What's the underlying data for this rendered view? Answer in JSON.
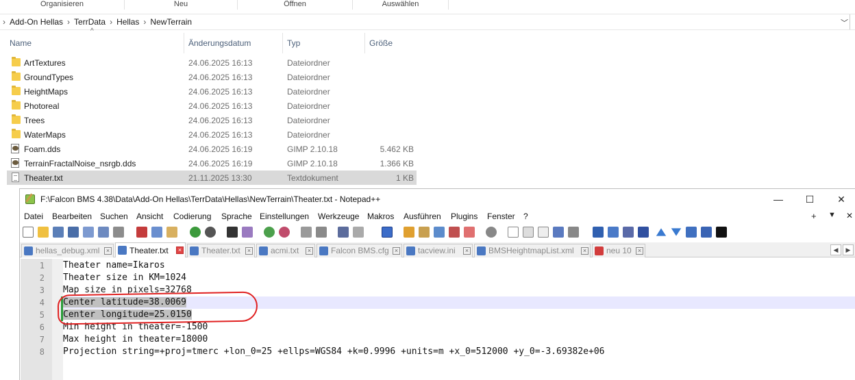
{
  "explorer": {
    "ribbon": [
      "Organisieren",
      "Neu",
      "Öffnen",
      "Auswählen"
    ],
    "breadcrumb": [
      "Add-On Hellas",
      "TerrData",
      "Hellas",
      "NewTerrain"
    ],
    "columns": {
      "name": "Name",
      "date": "Änderungsdatum",
      "type": "Typ",
      "size": "Größe"
    },
    "files": [
      {
        "name": "ArtTextures",
        "date": "24.06.2025 16:13",
        "type": "Dateiordner",
        "size": "",
        "icon": "folder-icon"
      },
      {
        "name": "GroundTypes",
        "date": "24.06.2025 16:13",
        "type": "Dateiordner",
        "size": "",
        "icon": "folder-icon"
      },
      {
        "name": "HeightMaps",
        "date": "24.06.2025 16:13",
        "type": "Dateiordner",
        "size": "",
        "icon": "folder-icon"
      },
      {
        "name": "Photoreal",
        "date": "24.06.2025 16:13",
        "type": "Dateiordner",
        "size": "",
        "icon": "folder-icon"
      },
      {
        "name": "Trees",
        "date": "24.06.2025 16:13",
        "type": "Dateiordner",
        "size": "",
        "icon": "folder-icon"
      },
      {
        "name": "WaterMaps",
        "date": "24.06.2025 16:13",
        "type": "Dateiordner",
        "size": "",
        "icon": "folder-icon"
      },
      {
        "name": "Foam.dds",
        "date": "24.06.2025 16:19",
        "type": "GIMP 2.10.18",
        "size": "5.462 KB",
        "icon": "gimp-file-icon"
      },
      {
        "name": "TerrainFractalNoise_nsrgb.dds",
        "date": "24.06.2025 16:19",
        "type": "GIMP 2.10.18",
        "size": "1.366 KB",
        "icon": "gimp-file-icon"
      },
      {
        "name": "Theater.txt",
        "date": "21.11.2025 13:30",
        "type": "Textdokument",
        "size": "1 KB",
        "icon": "text-file-icon",
        "selected": true
      }
    ]
  },
  "notepad": {
    "title": "F:\\Falcon BMS 4.38\\Data\\Add-On Hellas\\TerrData\\Hellas\\NewTerrain\\Theater.txt - Notepad++",
    "window_buttons": {
      "minimize": "—",
      "maximize": "☐",
      "close": "✕"
    },
    "menu": [
      "Datei",
      "Bearbeiten",
      "Suchen",
      "Ansicht",
      "Codierung",
      "Sprache",
      "Einstellungen",
      "Werkzeuge",
      "Makros",
      "Ausführen",
      "Plugins",
      "Fenster",
      "?"
    ],
    "menu_right": [
      "+",
      "▼",
      "✕"
    ],
    "tabs": [
      {
        "label": "hellas_debug.xml",
        "active": false
      },
      {
        "label": "Theater.txt",
        "active": true
      },
      {
        "label": "Theater.txt",
        "active": false
      },
      {
        "label": "acmi.txt",
        "active": false
      },
      {
        "label": "Falcon BMS.cfg",
        "active": false
      },
      {
        "label": "tacview.ini",
        "active": false
      },
      {
        "label": "BMSHeightmapList.xml",
        "active": false
      },
      {
        "label": "neu 10",
        "active": false
      }
    ],
    "lines": [
      {
        "num": "1",
        "text": "Theater name=Ikaros"
      },
      {
        "num": "2",
        "text": "Theater size in KM=1024"
      },
      {
        "num": "3",
        "text": "Map size in pixels=32768"
      },
      {
        "num": "4",
        "text": "Center latitude=38.0069"
      },
      {
        "num": "5",
        "text": "Center longitude=25.0150"
      },
      {
        "num": "6",
        "text": "Min height in theater=-1500"
      },
      {
        "num": "7",
        "text": "Max height in theater=18000"
      },
      {
        "num": "8",
        "text": "Projection string=+proj=tmerc +lon_0=25 +ellps=WGS84 +k=0.9996 +units=m +x_0=512000 +y_0=-3.69382e+06"
      }
    ]
  },
  "colors": {
    "selection": "#c0c0c0",
    "current_line": "#e8e8ff",
    "annotation": "#e02020",
    "change_marker": "#2a9d3a"
  }
}
